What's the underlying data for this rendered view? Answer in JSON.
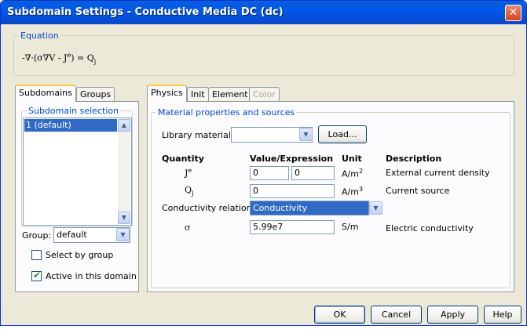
{
  "window": {
    "title": "Subdomain Settings - Conductive Media DC (dc)",
    "close_glyph": "✕"
  },
  "equation": {
    "legend": "Equation",
    "prefix": "-∇·(σ∇V - J",
    "sup": "e",
    "middle": ") = Q",
    "sub": "j"
  },
  "left_tabs": [
    {
      "label": "Subdomains"
    },
    {
      "label": "Groups"
    }
  ],
  "subdomain_selection": {
    "legend": "Subdomain selection",
    "items": [
      "1 (default)"
    ],
    "scroll_up": "▲",
    "scroll_down": "▼"
  },
  "group": {
    "label": "Group:",
    "value": "default",
    "drop_glyph": "▼"
  },
  "select_by_group": {
    "label": "Select by group",
    "checked": false
  },
  "active_in_domain": {
    "label": "Active in this domain",
    "checked": true,
    "mark": "✔"
  },
  "right_tabs": [
    {
      "label": "Physics"
    },
    {
      "label": "Init"
    },
    {
      "label": "Element"
    },
    {
      "label": "Color"
    }
  ],
  "material": {
    "legend": "Material properties and sources",
    "library_label": "Library material:",
    "library_value": "",
    "drop_glyph": "▼",
    "load_label": "Load..."
  },
  "table_headers": {
    "quantity": "Quantity",
    "value": "Value/Expression",
    "unit": "Unit",
    "description": "Description"
  },
  "rows": {
    "je": {
      "symbol": "J",
      "sup": "e",
      "value1": "0",
      "value2": "0",
      "unit": "A/m",
      "unit_sup": "2",
      "description": "External current density"
    },
    "qj": {
      "symbol": "Q",
      "sub": "j",
      "value": "0",
      "unit": "A/m",
      "unit_sup": "3",
      "description": "Current source"
    },
    "conductivity_relation": {
      "label": "Conductivity relation:",
      "value": "Conductivity",
      "drop_glyph": "▼"
    },
    "sigma": {
      "symbol": "σ",
      "value": "5.99e7",
      "unit": "S/m",
      "description": "Electric conductivity"
    }
  },
  "buttons": {
    "ok": "OK",
    "cancel": "Cancel",
    "apply": "Apply",
    "help": "Help"
  },
  "colors": {
    "title_bar": "#0058ee",
    "selection": "#316ac5",
    "legend_text": "#0046d5",
    "dialog_bg": "#ece9d8"
  }
}
